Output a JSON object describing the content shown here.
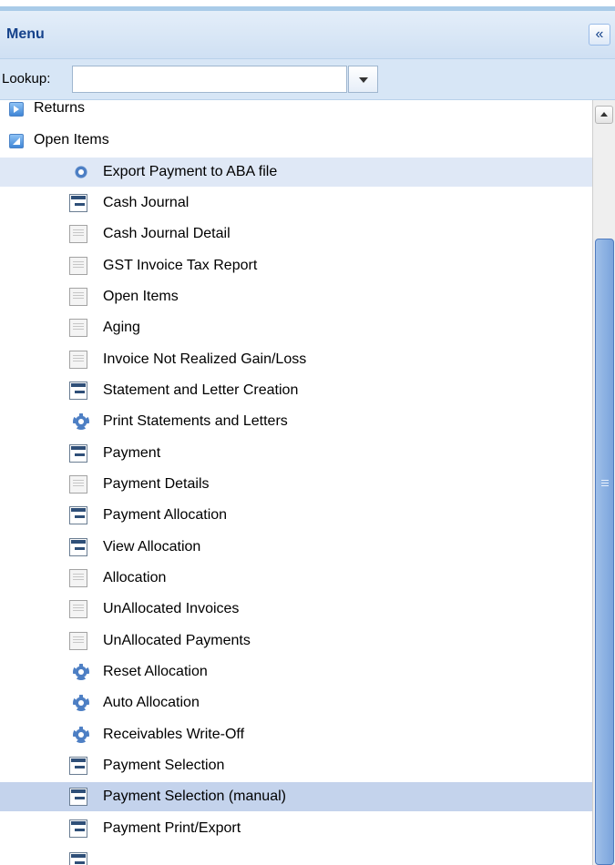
{
  "panel": {
    "title": "Menu",
    "collapse_glyph": "«"
  },
  "lookup": {
    "label": "Lookup:",
    "value": "",
    "placeholder": ""
  },
  "tree": {
    "items": [
      {
        "label": "Returns",
        "icon": "folder-collapsed-icon"
      },
      {
        "label": "Open Items",
        "icon": "folder-expanded-icon"
      },
      {
        "label": "Export Payment to ABA file",
        "icon": "gear-icon"
      },
      {
        "label": "Cash Journal",
        "icon": "window-icon"
      },
      {
        "label": "Cash Journal Detail",
        "icon": "report-icon"
      },
      {
        "label": "GST Invoice Tax Report",
        "icon": "report-icon"
      },
      {
        "label": "Open Items",
        "icon": "report-icon"
      },
      {
        "label": "Aging",
        "icon": "report-icon"
      },
      {
        "label": "Invoice Not Realized Gain/Loss",
        "icon": "report-icon"
      },
      {
        "label": "Statement and Letter Creation",
        "icon": "window-icon"
      },
      {
        "label": "Print Statements and Letters",
        "icon": "gear-icon"
      },
      {
        "label": "Payment",
        "icon": "window-icon"
      },
      {
        "label": "Payment Details",
        "icon": "report-icon"
      },
      {
        "label": "Payment Allocation",
        "icon": "window-icon"
      },
      {
        "label": "View Allocation",
        "icon": "window-icon"
      },
      {
        "label": "Allocation",
        "icon": "report-icon"
      },
      {
        "label": "UnAllocated Invoices",
        "icon": "report-icon"
      },
      {
        "label": "UnAllocated Payments",
        "icon": "report-icon"
      },
      {
        "label": "Reset Allocation",
        "icon": "gear-icon"
      },
      {
        "label": "Auto Allocation",
        "icon": "gear-icon"
      },
      {
        "label": "Receivables Write-Off",
        "icon": "gear-icon"
      },
      {
        "label": "Payment Selection",
        "icon": "window-icon"
      },
      {
        "label": "Payment Selection (manual)",
        "icon": "window-icon"
      },
      {
        "label": "Payment Print/Export",
        "icon": "window-icon"
      }
    ]
  },
  "colors": {
    "header_text": "#15428b",
    "hover_row": "#dfe8f6",
    "selected_row": "#c4d3ec",
    "scroll_thumb": "#7aa4dc"
  }
}
